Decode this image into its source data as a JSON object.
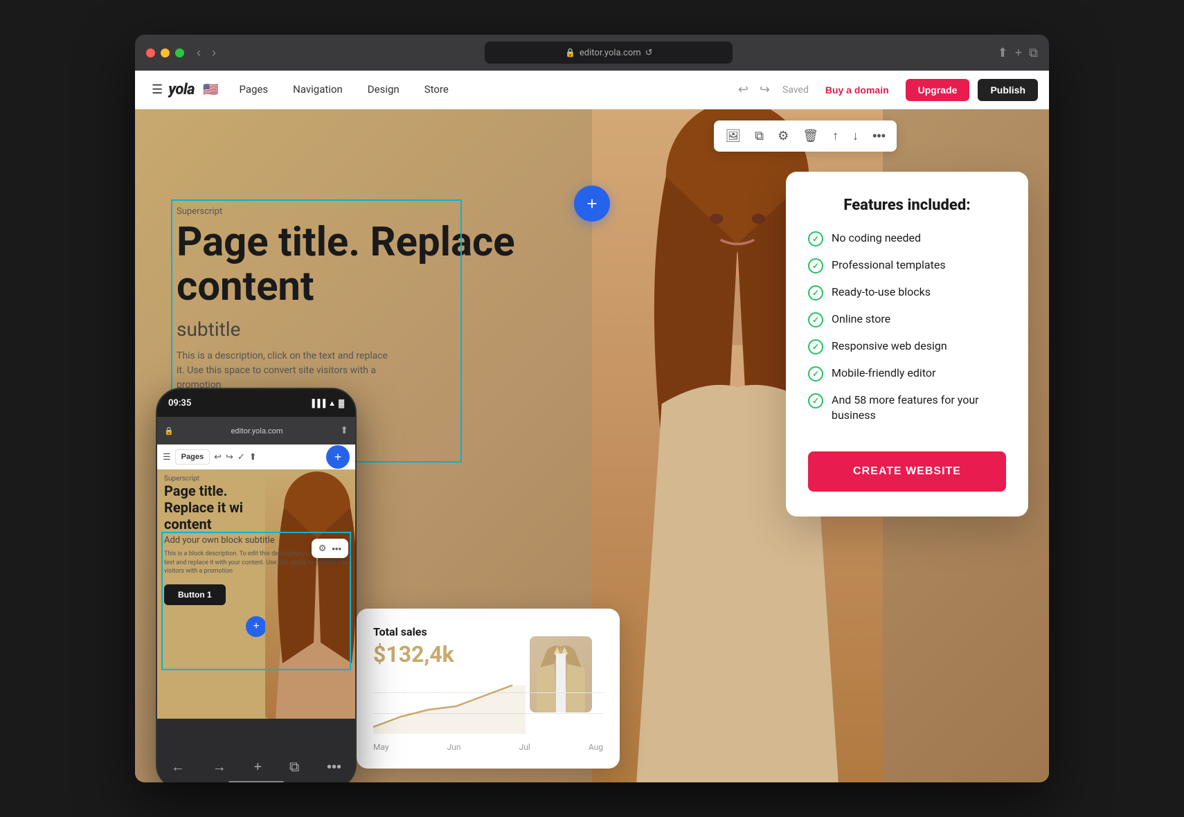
{
  "browser": {
    "address": "editor.yola.com",
    "reload_label": "↻"
  },
  "toolbar": {
    "menu_label": "☰",
    "logo": "yola",
    "nav_items": [
      "Pages",
      "Navigation",
      "Design",
      "Store"
    ],
    "saved_label": "Saved",
    "buy_domain_label": "Buy a domain",
    "upgrade_label": "Upgrade",
    "publish_label": "Publish"
  },
  "editor": {
    "add_button_label": "+",
    "superscript_label": "Superscript",
    "page_title": "Page title. Replace content",
    "subtitle": "subtitle",
    "description": "This is a block description. To edit this description, click on the text and replace it with your content. Use this space to convert site visitors with a promotion",
    "floating_toolbar": {
      "image_icon": "🖼",
      "copy_icon": "⧉",
      "settings_icon": "⚙",
      "delete_icon": "🗑",
      "move_up_icon": "↑",
      "move_down_icon": "↓",
      "more_icon": "•••"
    }
  },
  "features_card": {
    "title": "Features included:",
    "items": [
      "No coding needed",
      "Professional templates",
      "Ready-to-use blocks",
      "Online store",
      "Responsive web design",
      "Mobile-friendly editor",
      "And 58 more features for your business"
    ],
    "cta_label": "CREATE WEBSITE"
  },
  "mobile_phone": {
    "time": "09:35",
    "address": "editor.yola.com",
    "pages_label": "Pages",
    "add_label": "+",
    "superscript_label": "Superscript",
    "page_title": "Page title. Replace it with content",
    "subtitle": "Add your own block subtitle",
    "description": "This is a block description. To edit this description, click on the text and replace it with your content. Use this space to convert site visitors with a promotion",
    "button_label": "Button 1"
  },
  "sales_card": {
    "title": "Total sales",
    "amount": "$132,4k",
    "chart_labels": [
      "May",
      "Jun",
      "Jul",
      "Aug"
    ]
  },
  "colors": {
    "primary_blue": "#2563eb",
    "red": "#e81c4f",
    "gold": "#c8a96e",
    "check_green": "#22c55e"
  }
}
